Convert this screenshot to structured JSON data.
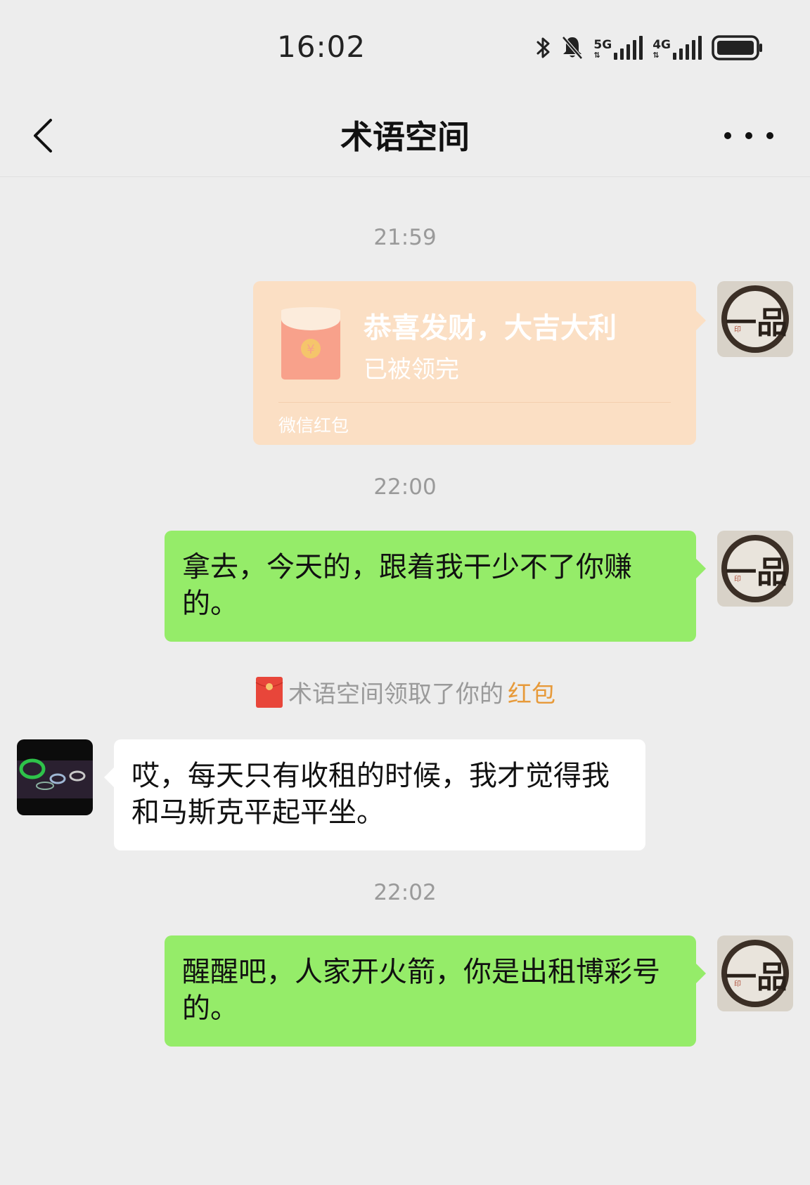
{
  "status_bar": {
    "time": "16:02",
    "network_1": "5G",
    "network_2": "4G",
    "icons": [
      "bluetooth-icon",
      "bell-mute-icon",
      "signal-icon",
      "signal-icon",
      "battery-icon"
    ]
  },
  "header": {
    "title": "术语空间",
    "back_icon": "chevron-left-icon",
    "more_icon": "more-dots-icon"
  },
  "chat": {
    "timestamps": [
      "21:59",
      "22:00",
      "22:02"
    ],
    "red_packet": {
      "title": "恭喜发财，大吉大利",
      "status": "已被领完",
      "brand": "微信红包",
      "icon_glyph": "¥",
      "colors": {
        "card": "#fbdfc4",
        "envelope": "#f8a18b",
        "coin": "#f5c56b"
      }
    },
    "messages": [
      {
        "sender": "me",
        "text": "拿去，今天的，跟着我干少不了你赚的。"
      },
      {
        "sender": "other",
        "text": "哎，每天只有收租的时候，我才觉得我和马斯克平起平坐。"
      },
      {
        "sender": "me",
        "text": "醒醒吧，人家开火箭，你是出租博彩号的。"
      }
    ],
    "system_notice": {
      "text": "术语空间领取了你的",
      "link": "红包"
    },
    "avatar_me_text": "一品",
    "avatar_me_seal": "印"
  },
  "colors": {
    "background": "#ededed",
    "bubble_me": "#95ec69",
    "bubble_other": "#ffffff",
    "timestamp": "#9a9a9a",
    "notice_link": "#e79a3a"
  }
}
